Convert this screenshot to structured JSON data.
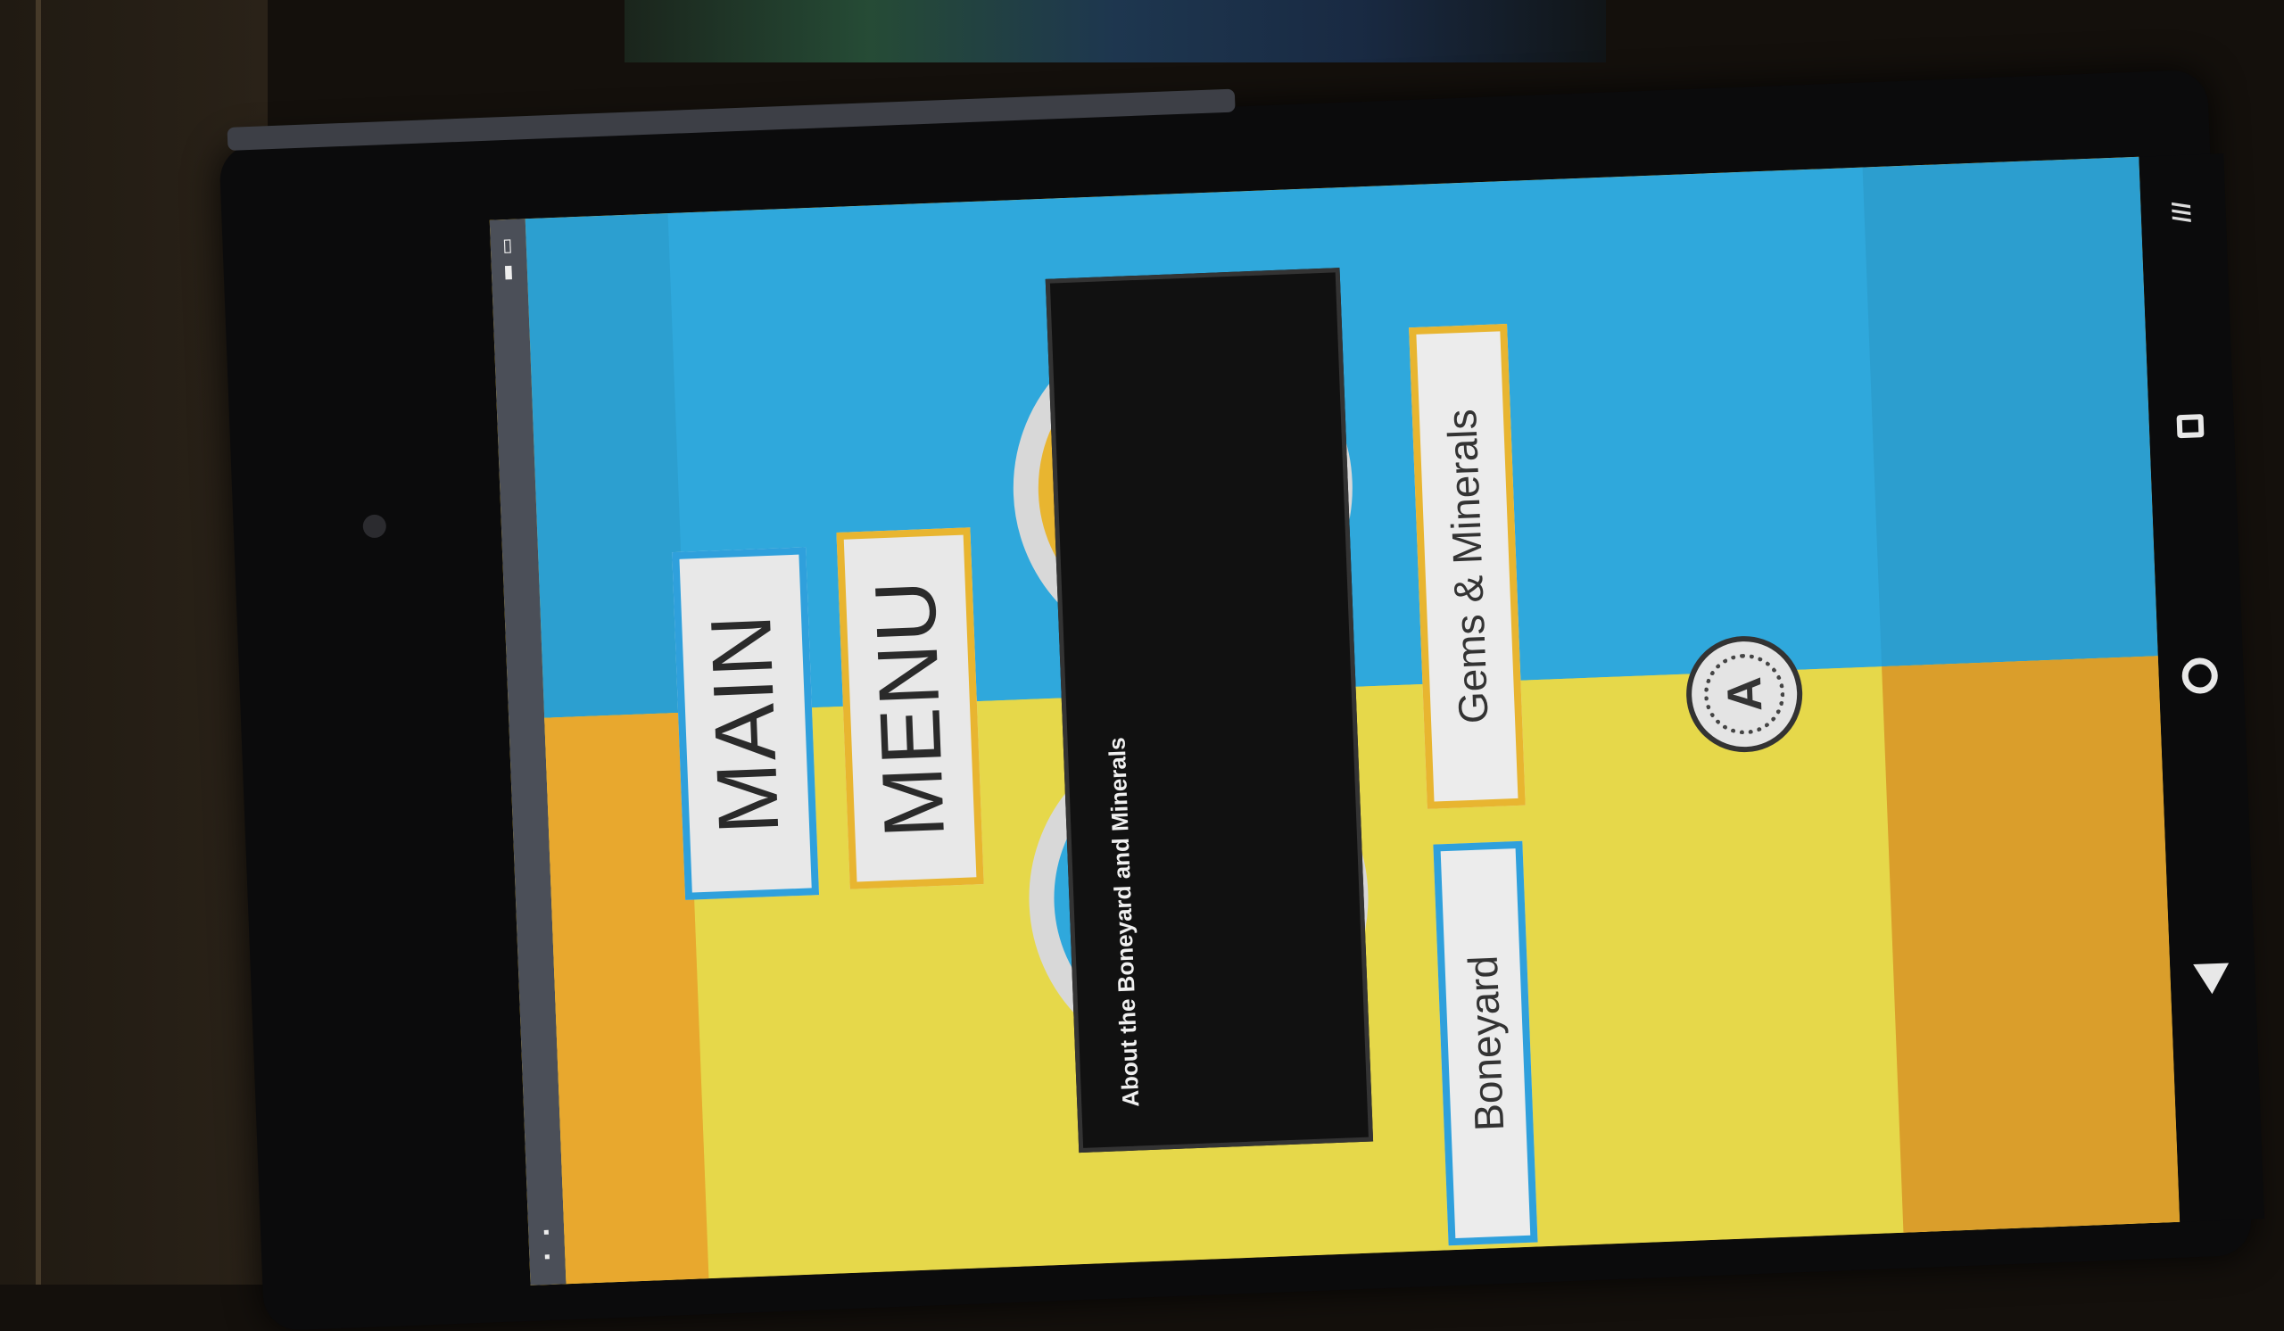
{
  "screen": {
    "title_line1": "MAIN",
    "title_line2": "MENU"
  },
  "dialog": {
    "title": "About the Boneyard and Minerals",
    "body": ""
  },
  "buttons": {
    "gems_label": "Gems & Minerals",
    "boneyard_label": "Boneyard"
  },
  "accessibility": {
    "label": "A",
    "icon": "accessibility-icon"
  },
  "navbar": {
    "back_icon": "back-icon",
    "home_icon": "home-icon",
    "recents_icon": "recents-icon"
  },
  "colors": {
    "blue": "#2fa8dc",
    "yellow": "#e6d84a",
    "orange": "#e8b530"
  }
}
